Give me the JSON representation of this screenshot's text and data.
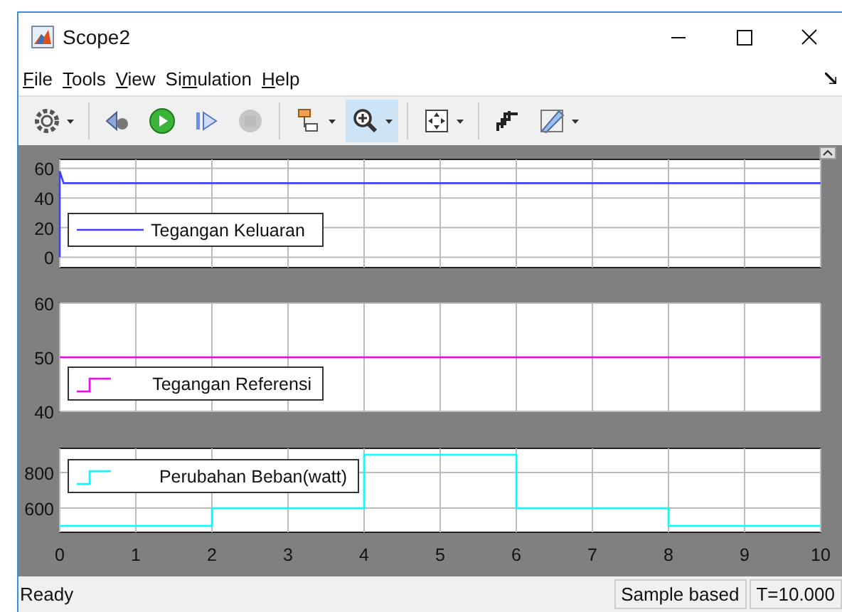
{
  "window": {
    "title": "Scope2"
  },
  "menu": [
    {
      "underlined": "F",
      "after": "ile"
    },
    {
      "underlined": "T",
      "after": "ools"
    },
    {
      "underlined": "V",
      "after": "iew"
    },
    {
      "before": "Si",
      "underlined": "m",
      "after": "ulation"
    },
    {
      "underlined": "H",
      "after": "elp"
    }
  ],
  "toolbar": [
    {
      "selected": false,
      "disabled": false,
      "dropdown": true
    },
    {
      "selected": false,
      "disabled": false,
      "dropdown": false
    },
    {
      "selected": false,
      "disabled": false,
      "dropdown": false
    },
    {
      "selected": false,
      "disabled": false,
      "dropdown": false
    },
    {
      "selected": false,
      "disabled": true,
      "dropdown": false
    },
    {
      "selected": false,
      "disabled": false,
      "dropdown": true
    },
    {
      "selected": true,
      "disabled": false,
      "dropdown": true
    },
    {
      "selected": false,
      "disabled": false,
      "dropdown": true
    },
    {
      "selected": false,
      "disabled": false,
      "dropdown": false
    },
    {
      "selected": false,
      "disabled": false,
      "dropdown": true
    }
  ],
  "plots": [
    {
      "chart_data": {
        "type": "line",
        "grid": true,
        "xlim": [
          0,
          10
        ],
        "ylim": [
          -7,
          66
        ],
        "yticks": [
          0,
          20,
          40,
          60
        ],
        "series": [
          {
            "name": "Tegangan Keluaran",
            "color": "#4040ff",
            "x": [
              0,
              0,
              0.05,
              10
            ],
            "values": [
              0,
              58,
              50,
              50
            ]
          }
        ]
      }
    },
    {
      "chart_data": {
        "type": "line",
        "grid": true,
        "xlim": [
          0,
          10
        ],
        "ylim": [
          40,
          60
        ],
        "yticks": [
          40,
          50,
          60
        ],
        "series": [
          {
            "name": "Tegangan Referensi",
            "color": "#ff00ff",
            "x": [
              0,
              10
            ],
            "values": [
              50,
              50
            ]
          }
        ]
      }
    },
    {
      "chart_data": {
        "type": "line",
        "grid": true,
        "xlim": [
          0,
          10
        ],
        "ylim": [
          464,
          936
        ],
        "yticks": [
          600,
          800
        ],
        "xticks": [
          0,
          1,
          2,
          3,
          4,
          5,
          6,
          7,
          8,
          9,
          10
        ],
        "series": [
          {
            "name": "Perubahan Beban(watt)",
            "color": "#00ffff",
            "x": [
              0,
              2,
              2,
              4,
              4,
              6,
              6,
              8,
              8,
              10
            ],
            "values": [
              500,
              500,
              600,
              600,
              900,
              900,
              600,
              600,
              500,
              500
            ]
          }
        ]
      }
    }
  ],
  "status_bar": {
    "message": "Ready",
    "mode": "Sample based",
    "time": "T=10.000"
  }
}
